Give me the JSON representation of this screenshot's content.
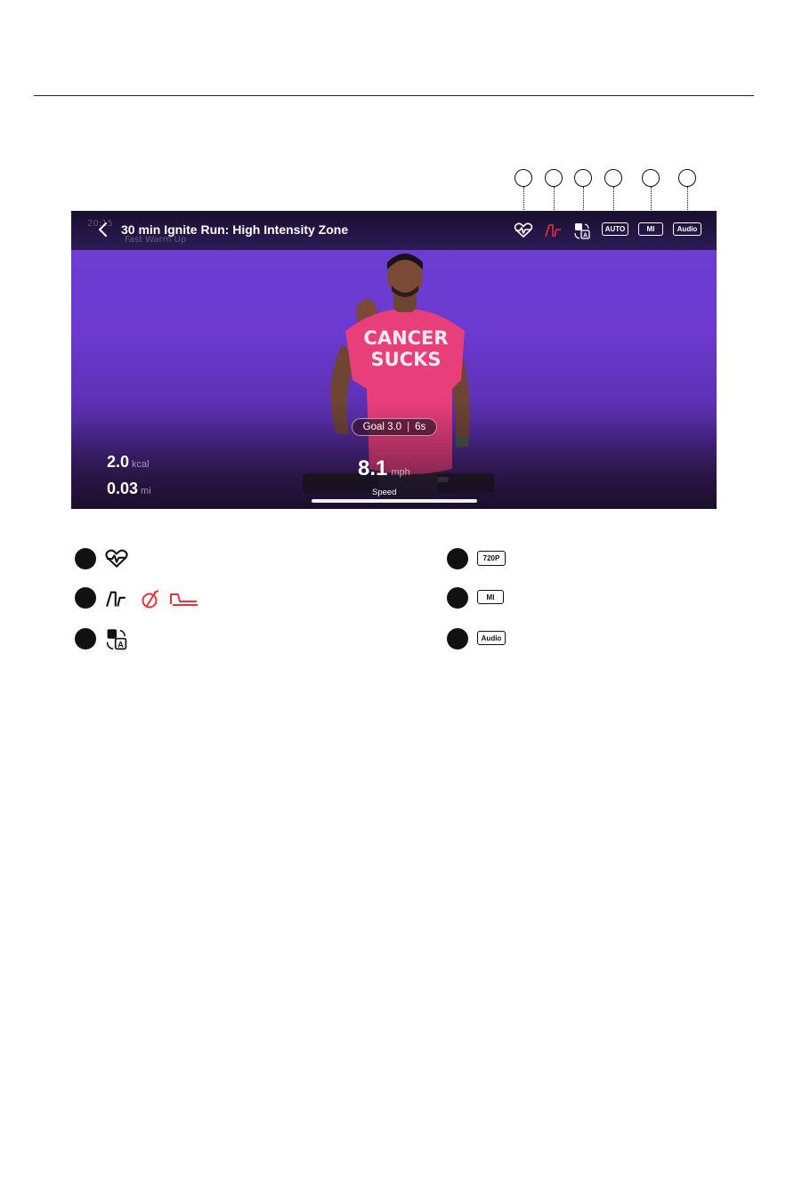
{
  "player": {
    "title": "30 min Ignite Run: High Intensity Zone",
    "ghost_title": "20:15",
    "ghost_subtitle": "Fast Warm Up",
    "controls": {
      "auto_label": "AUTO",
      "units_label": "MI",
      "audio_label": "Audio"
    },
    "goal": {
      "value": "Goal 3.0",
      "time": "6s"
    },
    "stats": {
      "calories_value": "2.0",
      "calories_unit": "kcal",
      "distance_value": "0.03",
      "distance_unit": "mi"
    },
    "speed": {
      "value": "8.1",
      "unit": "mph",
      "label": "Speed",
      "progress": 1.0
    },
    "trainer_shirt": {
      "line1": "CANCER",
      "line2": "SUCKS"
    }
  },
  "legend": {
    "resolution_label": "720P",
    "units_label": "MI",
    "audio_label": "Audio"
  },
  "colors": {
    "accent_red": "#e8323c",
    "background_purple": "#6a3fd2"
  }
}
